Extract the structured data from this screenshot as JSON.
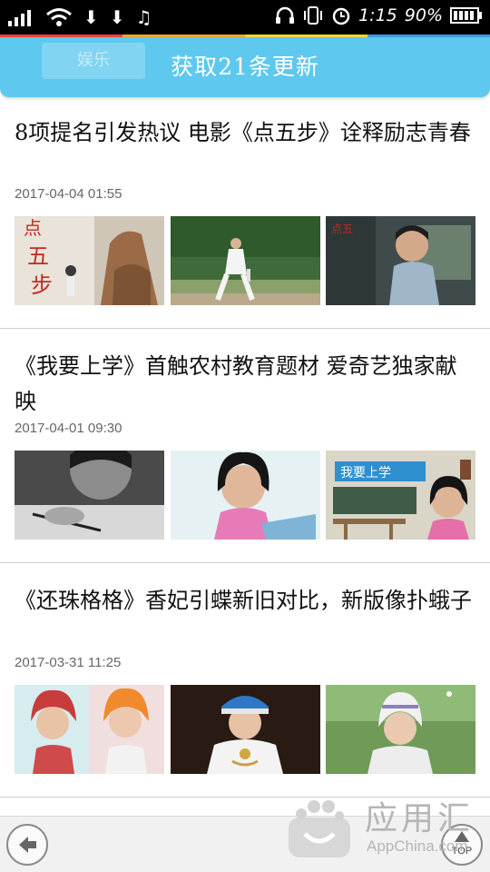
{
  "status_bar": {
    "time": "1:15",
    "battery": "90%"
  },
  "toast": {
    "message": "获取21条更新",
    "ghost_tab": "娱乐"
  },
  "colors": {
    "banner": "#5ec8ef",
    "status_strip": [
      "#e9443b",
      "#f1a52e",
      "#f3d531",
      "#3a9fe0"
    ]
  },
  "news": [
    {
      "title": "8项提名引发热议 电影《点五步》诠释励志青春",
      "date": "2017-04-04 01:55"
    },
    {
      "title": "《我要上学》首触农村教育题材 爱奇艺独家献映",
      "date": "2017-04-01 09:30",
      "thumb_text": "我要上学"
    },
    {
      "title": "《还珠格格》香妃引蝶新旧对比，新版像扑蛾子",
      "date": "2017-03-31 11:25"
    }
  ],
  "bottom_bar": {
    "top_label": "TOP"
  },
  "watermark": {
    "name": "应用汇",
    "domain": "AppChina.com"
  }
}
